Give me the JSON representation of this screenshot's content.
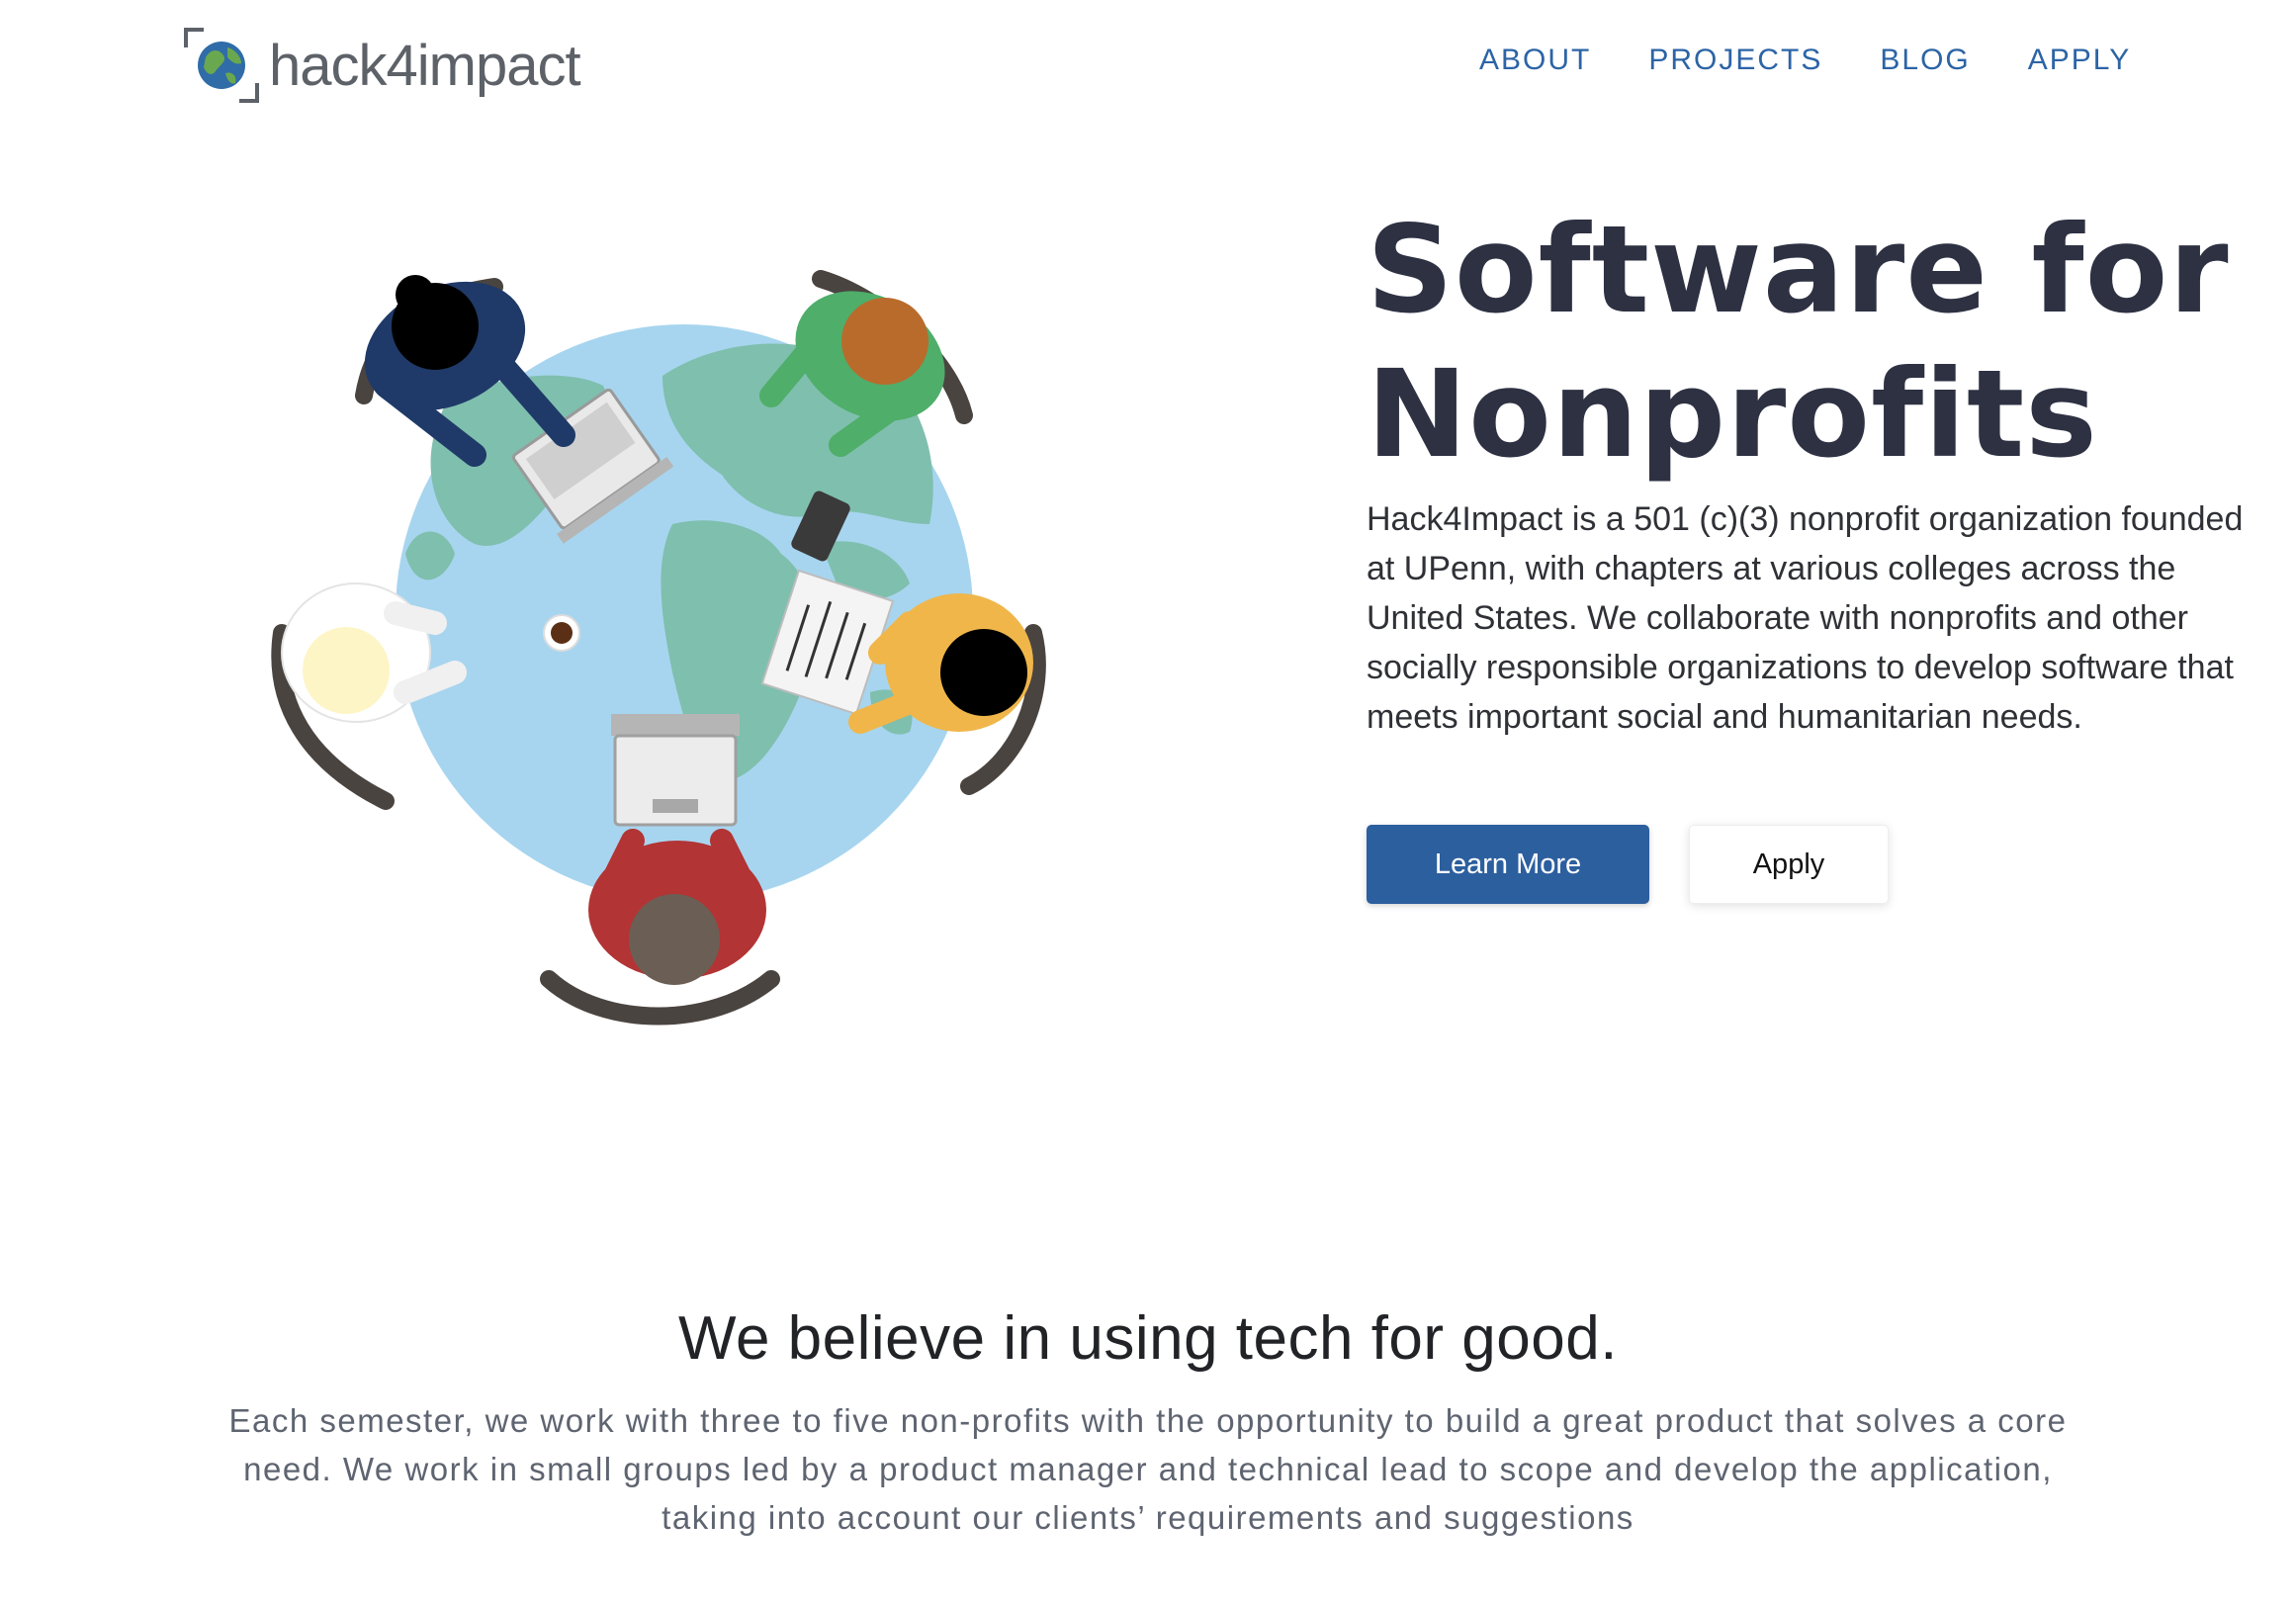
{
  "header": {
    "logo_text": "hack4impact",
    "nav": [
      "ABOUT",
      "PROJECTS",
      "BLOG",
      "APPLY"
    ]
  },
  "hero": {
    "title_line1": "Software for",
    "title_line2": "Nonprofits",
    "description": "Hack4Impact is a 501 (c)(3) nonprofit organization founded at UPenn, with chapters at various colleges across the United States. We collaborate with nonprofits and other socially responsible organizations to develop software that meets important social and humanitarian needs.",
    "primary_button": "Learn More",
    "secondary_button": "Apply"
  },
  "mission": {
    "title": "We believe in using tech for good.",
    "description": "Each semester, we work with three to five non-profits with the opportunity to build a great product that solves a core need. We work in small groups led by a product manager and technical lead to scope and develop the application, taking into account our clients’ requirements and suggestions"
  },
  "colors": {
    "brand_blue": "#2c5f9e",
    "nav_blue": "#2c64a6",
    "heading_dark": "#2d3142",
    "globe_ocean": "#a7d5ef",
    "globe_land": "#7fbfae"
  },
  "icons": [
    "globe-icon",
    "logo-bracket-icon"
  ]
}
